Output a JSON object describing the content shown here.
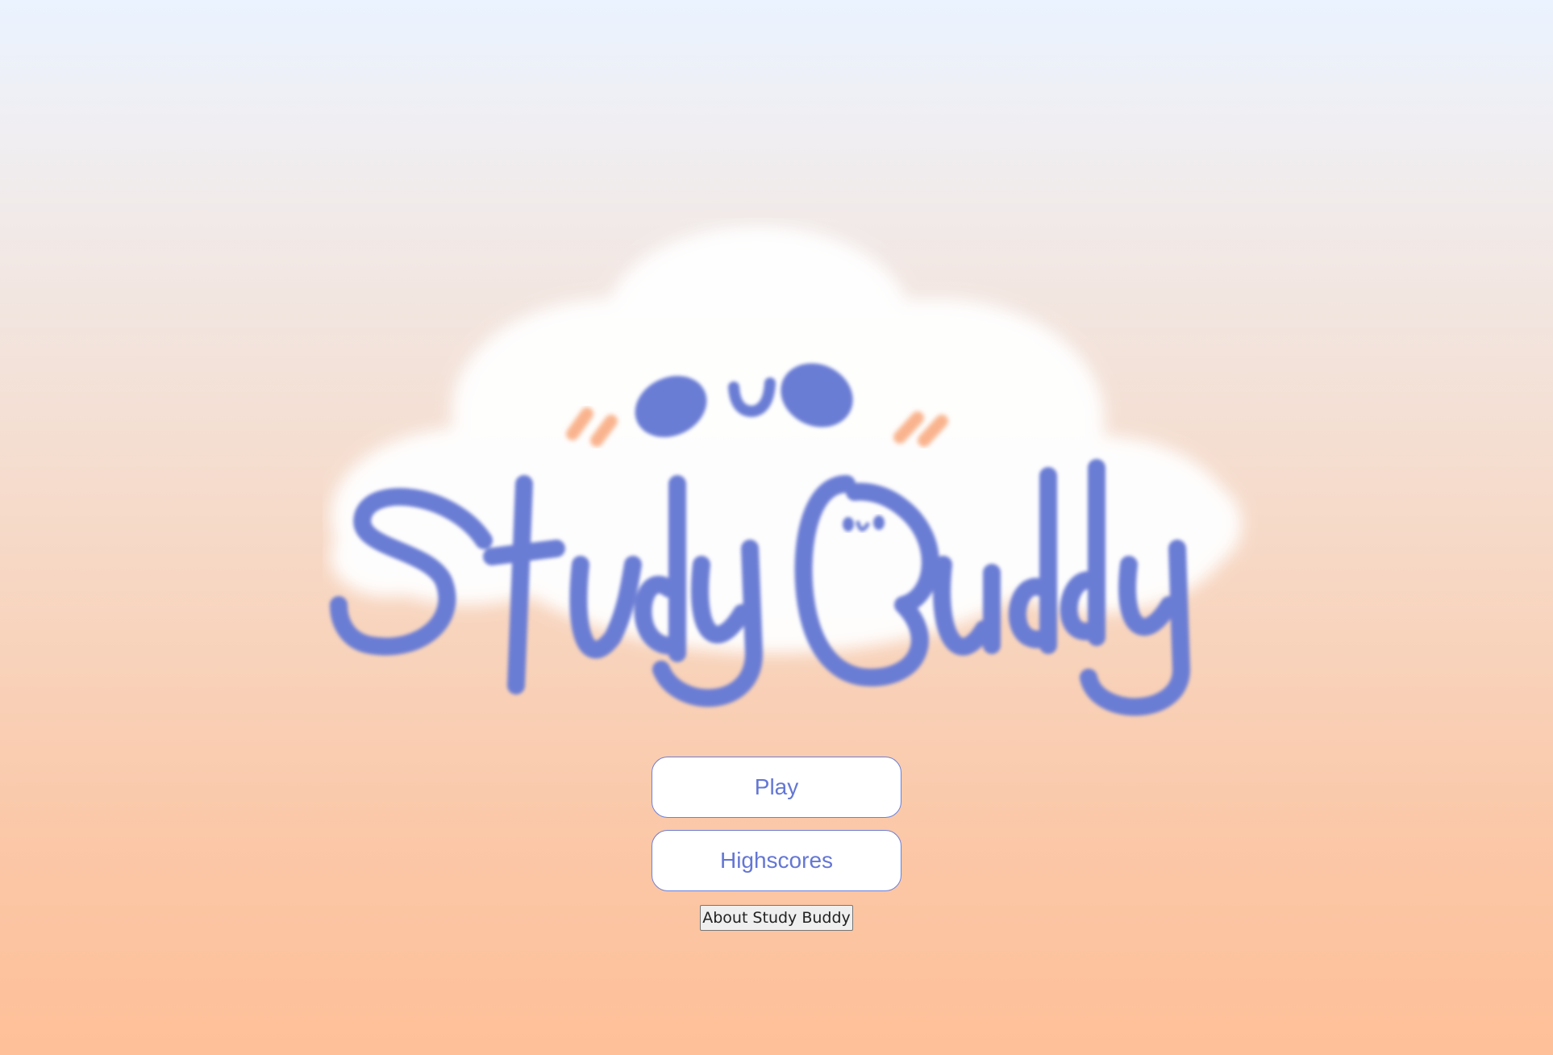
{
  "app": {
    "logo_text": "Study Buddy"
  },
  "menu": {
    "play_label": "Play",
    "highscores_label": "Highscores",
    "about_label": "About Study Buddy"
  },
  "colors": {
    "accent": "#6477d4",
    "blush": "#f9b48e",
    "background_top": "#eaf3ff",
    "background_bottom": "#fec098"
  }
}
